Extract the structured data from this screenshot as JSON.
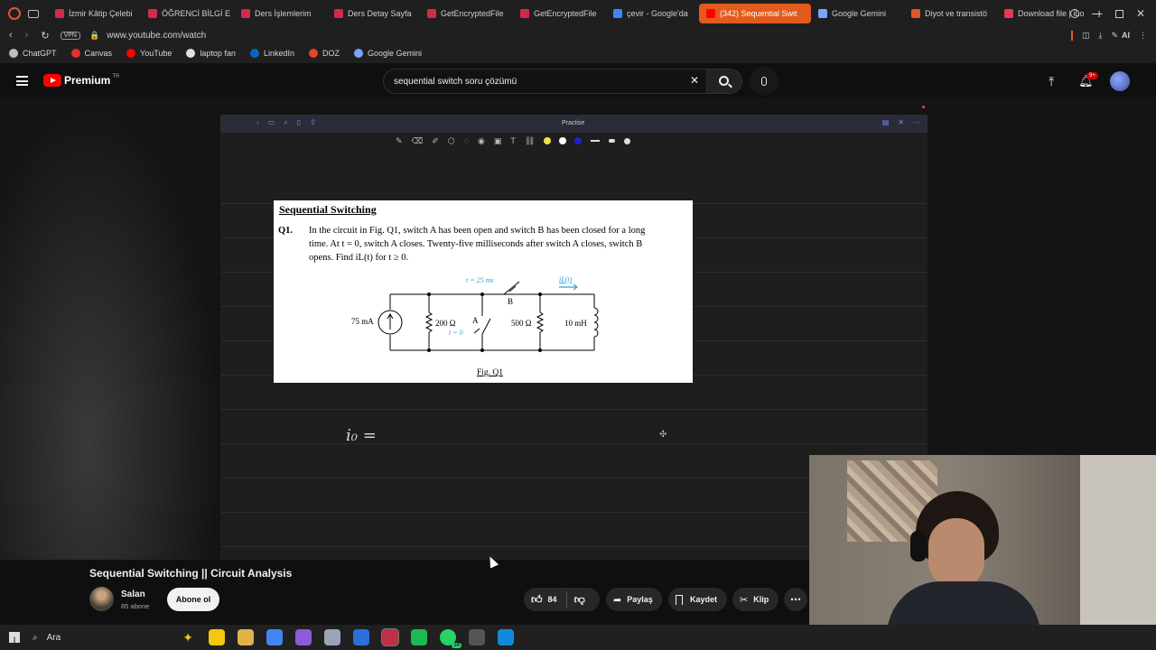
{
  "browser": {
    "tabs": [
      {
        "label": "İzmir Kâtip Çelebi",
        "color": "#d22b4a"
      },
      {
        "label": "ÖĞRENCİ BİLGİ E",
        "color": "#d22b4a"
      },
      {
        "label": "Ders İşlemlerim",
        "color": "#d22b4a"
      },
      {
        "label": "Ders Detay Sayfa",
        "color": "#d22b4a"
      },
      {
        "label": "GetEncryptedFile",
        "color": "#d22b4a"
      },
      {
        "label": "GetEncryptedFile",
        "color": "#d22b4a"
      },
      {
        "label": "çevir - Google'da",
        "color": "#4285f4"
      },
      {
        "label": "(342) Sequential Swit",
        "color": "#ff0000",
        "active": true
      },
      {
        "label": "Google Gemini",
        "color": "#7aa2ff"
      },
      {
        "label": "Diyot ve transistö",
        "color": "#e0562f"
      },
      {
        "label": "Download file | iLo",
        "color": "#e53950"
      }
    ],
    "url": "www.youtube.com/watch",
    "vpn_label": "VPN",
    "ai_label": "AI",
    "bookmarks": [
      {
        "label": "ChatGPT",
        "color": "#bdbdbd"
      },
      {
        "label": "Canvas",
        "color": "#e22f2f"
      },
      {
        "label": "YouTube",
        "color": "#ff0000"
      },
      {
        "label": "laptop fan",
        "color": "#e0e0e0"
      },
      {
        "label": "LinkedIn",
        "color": "#0a66c2"
      },
      {
        "label": "DOZ",
        "color": "#e8412c"
      },
      {
        "label": "Google Gemini",
        "color": "#7aa2ff"
      }
    ]
  },
  "youtube": {
    "logo_text": "Premium",
    "logo_region": "TR",
    "search_value": "sequential switch soru çözümü",
    "notif_count": "9+",
    "video_title": "Sequential Switching || Circuit Analysis",
    "channel_name": "Salan",
    "subscribers": "85 abone",
    "subscribe_label": "Abone ol",
    "likes": "84",
    "share_label": "Paylaş",
    "save_label": "Kaydet",
    "clip_label": "Klip"
  },
  "notes_app": {
    "title": "Practise",
    "colors": [
      "#f0e14a",
      "#ffffff",
      "#2020d0"
    ]
  },
  "problem": {
    "heading": "Sequential Switching",
    "qnum": "Q1.",
    "line1": "In the circuit in Fig. Q1, switch A has been open and switch B has been closed for a long",
    "line2": "time. At t = 0, switch A closes. Twenty-five milliseconds after switch A closes, switch B",
    "line3": "opens. Find iL(t) for t ≥ 0.",
    "source": "75 mA",
    "r1": "200 Ω",
    "r2": "500 Ω",
    "inductor": "10 mH",
    "switch_a": "A",
    "switch_b": "B",
    "t_a": "t = 0",
    "t_b": "t = 25 ms",
    "current": "iL(t)",
    "fig_label": "Fig. Q1"
  },
  "handwriting": "i₀ =",
  "taskbar": {
    "search_label": "Ara",
    "whatsapp_badge": "24",
    "icons": [
      "#f2c811",
      "#e0b34a",
      "#4285f4",
      "#8f5ad8",
      "#9aa4b8",
      "#2d6fd8",
      "#c0304a",
      "#1db954",
      "#25d366",
      "#555555",
      "#0f8adf"
    ]
  }
}
